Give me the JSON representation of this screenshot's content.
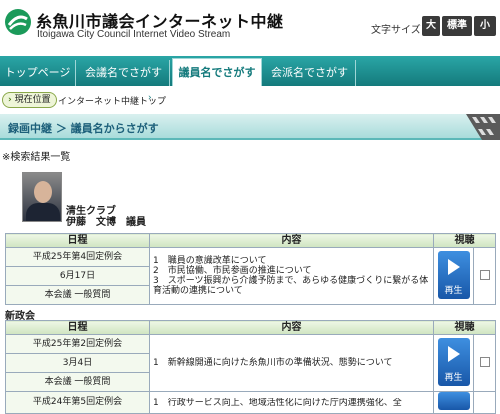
{
  "header": {
    "title": "糸魚川市議会インターネット中継",
    "subtitle": "Itoigawa City Council Internet Video Stream",
    "font_size_label": "文字サイズ",
    "font_sizes": [
      "大",
      "標準",
      "小"
    ]
  },
  "nav": {
    "tabs": [
      {
        "label": "トップページ",
        "active": false
      },
      {
        "label": "会議名でさがす",
        "active": false
      },
      {
        "label": "議員名でさがす",
        "active": true
      },
      {
        "label": "会派名でさがす",
        "active": false
      }
    ]
  },
  "breadcrumb": {
    "badge": "現在位置",
    "path": "インターネット中継トップ",
    "separator": "›"
  },
  "section": {
    "title": "録画中継 ＞ 議員名からさがす"
  },
  "results_label": "※検索結果一覧",
  "member": {
    "party": "清生クラブ",
    "name": "伊藤　文博　議員"
  },
  "table_headers": {
    "date": "日程",
    "content": "内容",
    "view": "視聴"
  },
  "play_label": "再生",
  "groups": [
    {
      "party": "",
      "rows": [
        {
          "session": "平成25年第4回定例会",
          "date": "6月17日",
          "meeting": "本会議 一般質問",
          "content": [
            "1　職員の意識改革について",
            "2　市民協働、市民参画の推進について",
            "3　スポーツ振興から介護予防まで、あらゆる健康づくりに繋がる体育活動の連携について"
          ]
        }
      ]
    },
    {
      "party": "新政会",
      "rows": [
        {
          "session": "平成25年第2回定例会",
          "date": "3月4日",
          "meeting": "本会議 一般質問",
          "content": [
            "1　新幹線開通に向けた糸魚川市の準備状況、態勢について"
          ]
        },
        {
          "session": "平成24年第5回定例会",
          "date": "",
          "meeting": "",
          "content": [
            "1　行政サービス向上、地域活性化に向けた庁内連携強化、全"
          ]
        }
      ]
    }
  ],
  "colors": {
    "nav": "#147a7c",
    "play": "#1857a8"
  }
}
